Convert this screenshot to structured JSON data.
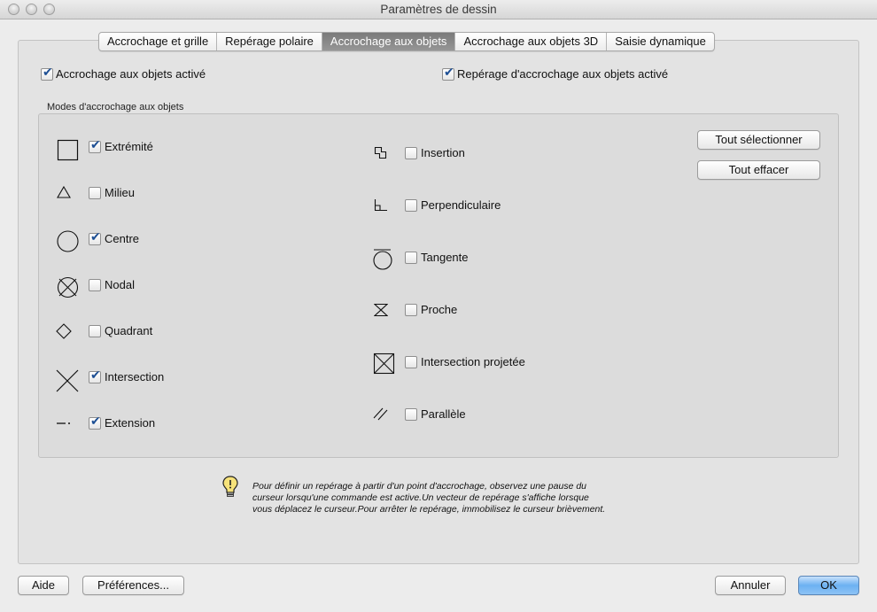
{
  "window": {
    "title": "Paramètres de dessin"
  },
  "tabs": [
    {
      "label": "Accrochage et grille"
    },
    {
      "label": "Repérage polaire"
    },
    {
      "label": "Accrochage aux objets"
    },
    {
      "label": "Accrochage aux objets 3D"
    },
    {
      "label": "Saisie dynamique"
    }
  ],
  "active_tab": "Accrochage aux objets",
  "top_options": {
    "osnap_on": {
      "label": "Accrochage aux objets activé",
      "checked": true
    },
    "tracking_on": {
      "label": "Repérage d'accrochage aux objets activé",
      "checked": true
    }
  },
  "modes": {
    "group_label": "Modes d'accrochage aux objets",
    "left": [
      {
        "label": "Extrémité",
        "checked": true,
        "icon": "square-icon"
      },
      {
        "label": "Milieu",
        "checked": false,
        "icon": "triangle-icon"
      },
      {
        "label": "Centre",
        "checked": true,
        "icon": "circle-icon"
      },
      {
        "label": "Nodal",
        "checked": false,
        "icon": "circle-x-icon"
      },
      {
        "label": "Quadrant",
        "checked": false,
        "icon": "diamond-icon"
      },
      {
        "label": "Intersection",
        "checked": true,
        "icon": "x-icon"
      },
      {
        "label": "Extension",
        "checked": true,
        "icon": "dash-dot-icon"
      }
    ],
    "right": [
      {
        "label": "Insertion",
        "checked": false,
        "icon": "insertion-icon"
      },
      {
        "label": "Perpendiculaire",
        "checked": false,
        "icon": "perpendicular-icon"
      },
      {
        "label": "Tangente",
        "checked": false,
        "icon": "tangent-icon"
      },
      {
        "label": "Proche",
        "checked": false,
        "icon": "hourglass-icon"
      },
      {
        "label": "Intersection projetée",
        "checked": false,
        "icon": "boxed-x-icon"
      },
      {
        "label": "Parallèle",
        "checked": false,
        "icon": "parallel-icon"
      }
    ],
    "select_all_label": "Tout sélectionner",
    "clear_all_label": "Tout effacer"
  },
  "hint": {
    "line1": "Pour définir un repérage à partir d'un point d'accrochage, observez une pause du",
    "line2": "curseur lorsqu'une commande est active.Un vecteur de repérage s'affiche lorsque",
    "line3": "vous déplacez le curseur.Pour arrêter le repérage, immobilisez le curseur brièvement."
  },
  "footer": {
    "help_label": "Aide",
    "prefs_label": "Préférences...",
    "cancel_label": "Annuler",
    "ok_label": "OK"
  },
  "colors": {
    "accent": "#6cb1f2",
    "check": "#1d4f94",
    "active_tab": "#858585"
  }
}
